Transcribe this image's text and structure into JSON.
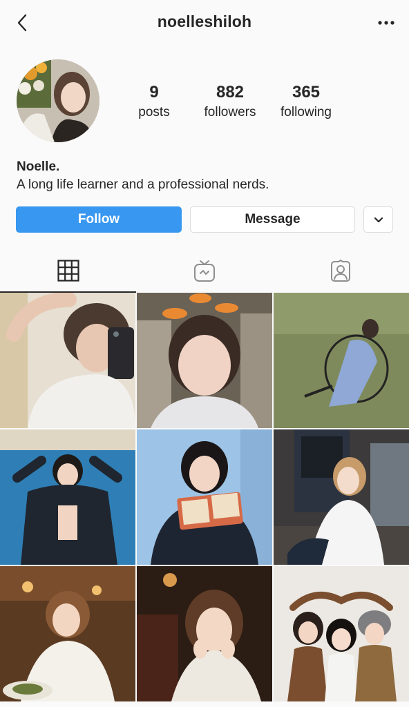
{
  "header": {
    "username": "noelleshiloh",
    "back_icon": "chevron-left-icon",
    "more_icon": "more-horizontal-icon"
  },
  "profile": {
    "posts": {
      "count": "9",
      "label": "posts"
    },
    "followers": {
      "count": "882",
      "label": "followers"
    },
    "following": {
      "count": "365",
      "label": "following"
    },
    "display_name": "Noelle.",
    "bio": "A long life learner and a professional nerds."
  },
  "actions": {
    "follow_label": "Follow",
    "message_label": "Message",
    "dropdown_icon": "chevron-down-icon"
  },
  "tabs": [
    {
      "name": "grid",
      "icon": "grid-icon",
      "active": true
    },
    {
      "name": "igtv",
      "icon": "igtv-icon",
      "active": false
    },
    {
      "name": "tagged",
      "icon": "tagged-person-icon",
      "active": false
    }
  ],
  "colors": {
    "accent": "#3897f0",
    "text": "#262626",
    "background": "#fafafa",
    "border": "#dbdbdb"
  },
  "grid_posts": [
    {
      "subject": "selfie in mirror holding phone"
    },
    {
      "subject": "selfie in car with fish stickers"
    },
    {
      "subject": "woman in blue dress on chair in grass"
    },
    {
      "subject": "woman against blue wall"
    },
    {
      "subject": "woman reading book"
    },
    {
      "subject": "woman outside pub"
    },
    {
      "subject": "woman in restaurant"
    },
    {
      "subject": "woman in dim bar"
    },
    {
      "subject": "three friends making heart"
    }
  ]
}
